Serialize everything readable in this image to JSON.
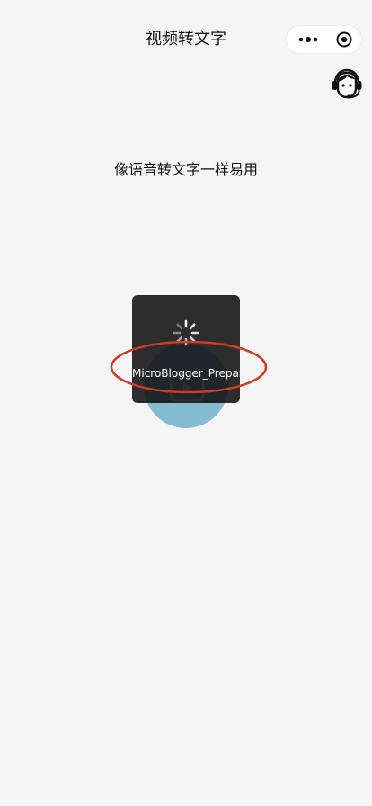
{
  "nav": {
    "title": "视频转文字",
    "more_icon": "more-dots-icon",
    "close_icon": "target-circle-icon"
  },
  "header": {
    "service_icon": "customer-service-headset-icon"
  },
  "main": {
    "tagline": "像语音转文字一样易用",
    "upload_icon": "video-icon",
    "upload_color": "#86bcd1"
  },
  "toast": {
    "text": "MicroBlogger_Preparing",
    "icon": "loading-spinner-icon"
  },
  "colors": {
    "background": "#f5f5f5",
    "annotation": "#d03a2a"
  }
}
